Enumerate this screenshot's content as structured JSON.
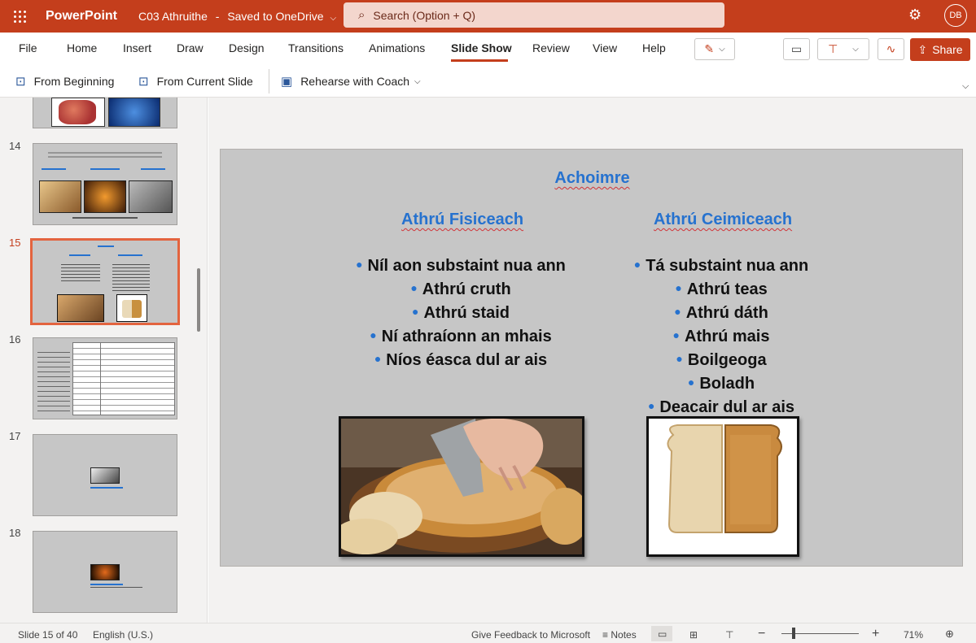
{
  "topbar": {
    "app_name": "PowerPoint",
    "doc_name": "C03 Athruithe",
    "save_status": "Saved to OneDrive",
    "search_placeholder": "Search (Option + Q)",
    "avatar_initials": "DB",
    "accent_color": "#c43e1c"
  },
  "menu": {
    "items": [
      "File",
      "Home",
      "Insert",
      "Draw",
      "Design",
      "Transitions",
      "Animations",
      "Slide Show",
      "Review",
      "View",
      "Help"
    ],
    "active": "Slide Show",
    "share_label": "Share"
  },
  "ribbon": {
    "from_beginning": "From Beginning",
    "from_current": "From Current Slide",
    "rehearse": "Rehearse with Coach"
  },
  "thumbnails": {
    "numbers": [
      "14",
      "15",
      "16",
      "17",
      "18"
    ],
    "active": "15"
  },
  "slide": {
    "title": "Achoimre",
    "left_heading": "Athrú Fisiceach",
    "right_heading": "Athrú Ceimiceach",
    "left_bullets": [
      "Níl aon substaint nua ann",
      "Athrú cruth",
      "Athrú staid",
      "Ní athraíonn an mhais",
      "Níos éasca dul ar ais"
    ],
    "right_bullets": [
      "Tá substaint nua ann",
      "Athrú teas",
      "Athrú dáth",
      "Athrú mais",
      "Boilgeoga",
      "Boladh",
      "Deacair dul ar ais"
    ],
    "bullet_glyph": "●"
  },
  "status": {
    "slide_info": "Slide 15 of 40",
    "language": "English (U.S.)",
    "feedback": "Give Feedback to Microsoft",
    "notes": "Notes",
    "zoom": "71%"
  }
}
